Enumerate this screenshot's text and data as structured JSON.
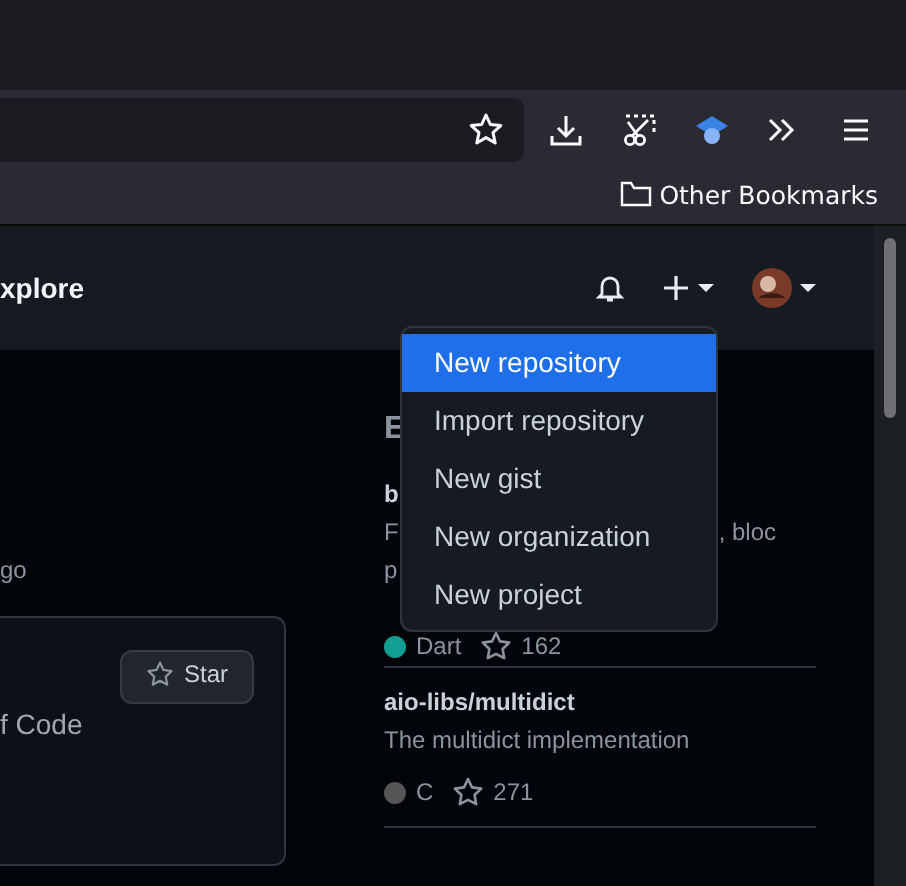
{
  "browser": {
    "bookmarks": [
      {
        "label": "Other Bookmarks"
      }
    ]
  },
  "header": {
    "title": "xplore"
  },
  "create_menu": {
    "items": [
      {
        "label": "New repository",
        "selected": true
      },
      {
        "label": "Import repository",
        "selected": false
      },
      {
        "label": "New gist",
        "selected": false
      },
      {
        "label": "New organization",
        "selected": false
      },
      {
        "label": "New project",
        "selected": false
      }
    ]
  },
  "feed": {
    "time_fragment": "go",
    "card": {
      "text": "f Code",
      "star_button": "Star"
    }
  },
  "explore": {
    "heading": "E",
    "partial_repo": {
      "name": "b",
      "description_start": "F",
      "description_end": ", bloc",
      "description_line2": "p",
      "language": "Dart",
      "color": "#139e93",
      "stars": "162"
    },
    "repos": [
      {
        "name": "aio-libs/multidict",
        "description": "The multidict implementation",
        "language": "C",
        "color": "#555555",
        "stars": "271"
      }
    ]
  }
}
